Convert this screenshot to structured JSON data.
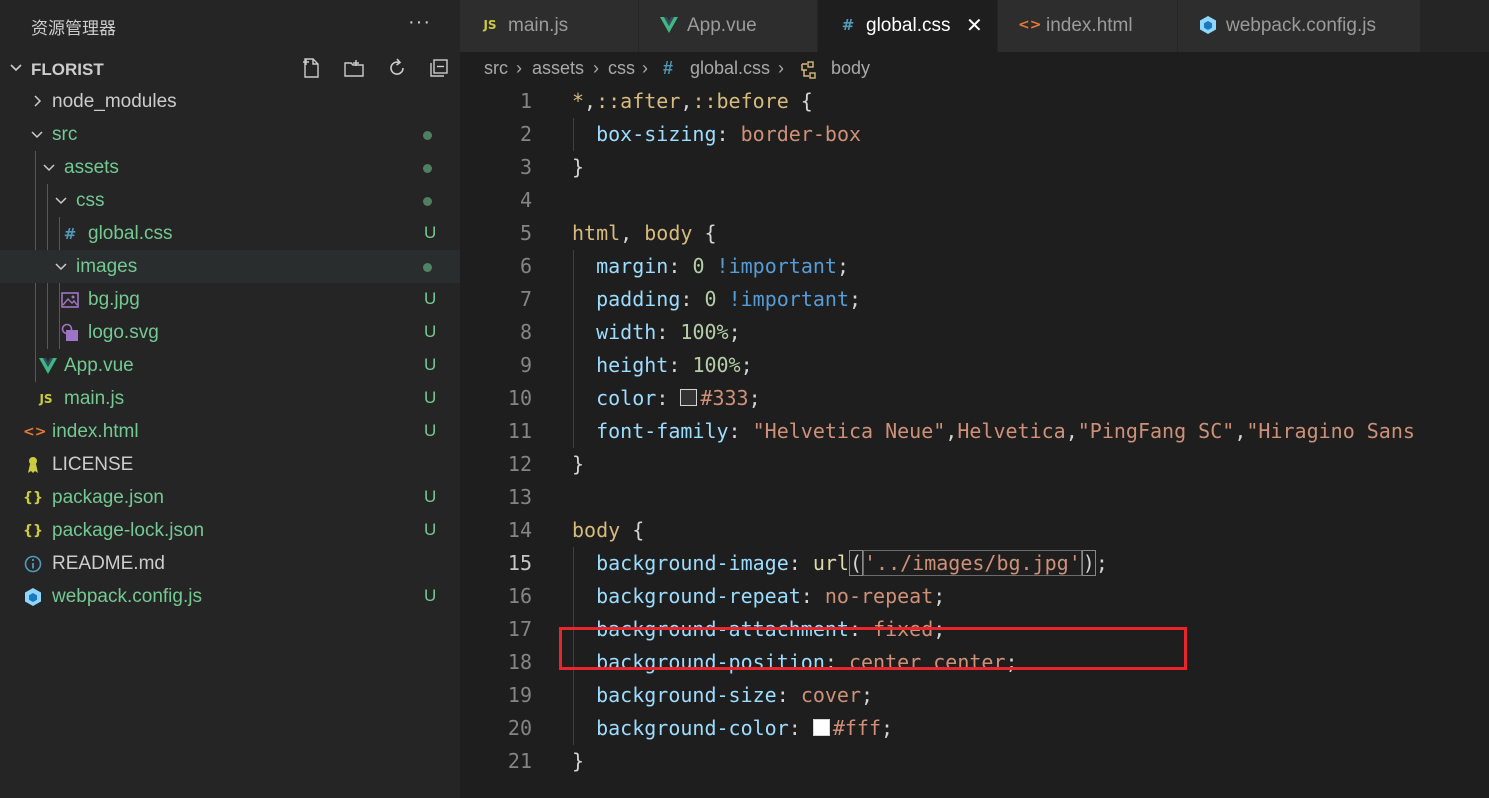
{
  "sidebar": {
    "title": "资源管理器",
    "more": "···",
    "project": "FLORIST",
    "items": [
      {
        "label": "node_modules",
        "status": ""
      },
      {
        "label": "src",
        "status": "dot"
      },
      {
        "label": "assets",
        "status": "dot"
      },
      {
        "label": "css",
        "status": "dot"
      },
      {
        "label": "global.css",
        "status": "U"
      },
      {
        "label": "images",
        "status": "dot"
      },
      {
        "label": "bg.jpg",
        "status": "U"
      },
      {
        "label": "logo.svg",
        "status": "U"
      },
      {
        "label": "App.vue",
        "status": "U"
      },
      {
        "label": "main.js",
        "status": "U"
      },
      {
        "label": "index.html",
        "status": "U"
      },
      {
        "label": "LICENSE",
        "status": ""
      },
      {
        "label": "package.json",
        "status": "U"
      },
      {
        "label": "package-lock.json",
        "status": "U"
      },
      {
        "label": "README.md",
        "status": ""
      },
      {
        "label": "webpack.config.js",
        "status": "U"
      }
    ]
  },
  "tabs": [
    {
      "label": "main.js",
      "icon": "JS"
    },
    {
      "label": "App.vue",
      "icon": "V"
    },
    {
      "label": "global.css",
      "icon": "#",
      "active": true
    },
    {
      "label": "index.html",
      "icon": "<>"
    },
    {
      "label": "webpack.config.js",
      "icon": "cube"
    }
  ],
  "breadcrumb": [
    "src",
    "assets",
    "css",
    "global.css",
    "body"
  ],
  "line_numbers": [
    "1",
    "2",
    "3",
    "4",
    "5",
    "6",
    "7",
    "8",
    "9",
    "10",
    "11",
    "12",
    "13",
    "14",
    "15",
    "16",
    "17",
    "18",
    "19",
    "20",
    "21"
  ],
  "code": {
    "l1": {
      "sel": "*",
      "p1": ",",
      "sel2": "::after",
      "p2": ",",
      "sel3": "::before",
      "brace": " {"
    },
    "l2": {
      "prop": "box-sizing",
      "colon": ": ",
      "val": "border-box"
    },
    "l3": {
      "brace": "}"
    },
    "l5": {
      "sel": "html",
      "p1": ", ",
      "sel2": "body",
      "brace": " {"
    },
    "l6": {
      "prop": "margin",
      "colon": ": ",
      "num": "0",
      "imp": " !important",
      "semi": ";"
    },
    "l7": {
      "prop": "padding",
      "colon": ": ",
      "num": "0",
      "imp": " !important",
      "semi": ";"
    },
    "l8": {
      "prop": "width",
      "colon": ": ",
      "num": "100%",
      "semi": ";"
    },
    "l9": {
      "prop": "height",
      "colon": ": ",
      "num": "100%",
      "semi": ";"
    },
    "l10": {
      "prop": "color",
      "colon": ": ",
      "val": "#333",
      "semi": ";"
    },
    "l11": {
      "prop": "font-family",
      "colon": ": ",
      "v1": "\"Helvetica Neue\"",
      "c1": ",",
      "v2": "Helvetica",
      "c2": ",",
      "v3": "\"PingFang SC\"",
      "c3": ",",
      "v4": "\"Hiragino Sans"
    },
    "l12": {
      "brace": "}"
    },
    "l14": {
      "sel": "body",
      "brace": " {"
    },
    "l15": {
      "prop": "background-image",
      "colon": ": ",
      "fn": "url",
      "po": "(",
      "str": "'../images/bg.jpg'",
      "pc": ")",
      "semi": ";"
    },
    "l16": {
      "prop": "background-repeat",
      "colon": ": ",
      "val": "no-repeat",
      "semi": ";"
    },
    "l17": {
      "prop": "background-attachment",
      "colon": ": ",
      "val": "fixed",
      "semi": ";"
    },
    "l18": {
      "prop": "background-position",
      "colon": ": ",
      "val": "center center",
      "semi": ";"
    },
    "l19": {
      "prop": "background-size",
      "colon": ": ",
      "val": "cover",
      "semi": ";"
    },
    "l20": {
      "prop": "background-color",
      "colon": ": ",
      "val": "#fff",
      "semi": ";"
    },
    "l21": {
      "brace": "}"
    }
  },
  "colors": {
    "accent_green": "#73c991",
    "highlight_box": "#e8262c",
    "swatch_333": "#333333",
    "swatch_fff": "#ffffff"
  }
}
